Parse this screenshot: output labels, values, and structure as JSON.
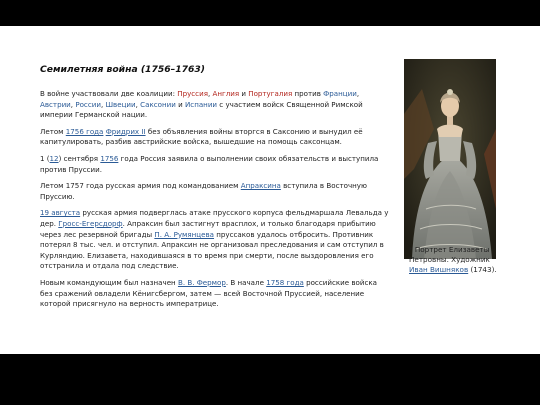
{
  "article": {
    "title": "Семилетняя война (1756–1763)",
    "p1": {
      "t1": "В войне участвовали две коалиции: ",
      "prussia": "Пруссия",
      "c1": ", ",
      "england": "Англия",
      "t2": " и ",
      "portugal": "Португалия",
      "t3": " против ",
      "france": "Франции",
      "c2": ", ",
      "austria": "Австрии",
      "c3": ", ",
      "russia": "России",
      "c4": ", ",
      "sweden": "Швеции",
      "c5": ", ",
      "saxony": "Саксонии",
      "t4": " и ",
      "spain": "Испании",
      "t5": " с участием войск Священной Римской империи Германской нации."
    },
    "p2": {
      "t1": "Летом ",
      "link_year": "1756 года",
      "t2": " ",
      "link_king": "Фридрих II",
      "t3": " без объявления войны вторгся в Саксонию и вынудил её капитулировать, разбив австрийские войска, вышедшие на помощь саксонцам."
    },
    "p3": {
      "t1": "1 (",
      "link_day": "12",
      "t2": ") сентября ",
      "link_year": "1756",
      "t3": " года Россия заявила о выполнении своих обязательств и выступила против Пруссии."
    },
    "p4": {
      "t1": "Летом 1757 года русская армия под командованием ",
      "link_apraksin": "Апраксина",
      "t2": " вступила в Восточную Пруссию."
    },
    "p5": {
      "link_date": "19 августа",
      "t1": " русская армия подверглась атаке прусского корпуса фельдмаршала Левальда у дер. ",
      "link_village": "Гросс-Егерсдорф",
      "t2": ". Апраксин был застигнут врасплох, и только благодаря прибытию через лес резервной бригады ",
      "link_rumyantsev": "П. А. Румянцева",
      "t3": " пруссаков удалось отбросить. Противник потерял 8 тыс. чел. и отступил. Апраксин не организовал преследования и сам отступил в Курляндию. Елизавета, находившаяся в то время при смерти, после выздоровления его отстранила и отдала под следствие."
    },
    "p6": {
      "t1": "Новым командующим был назначен ",
      "link_fermor": "В. В. Фермор",
      "t2": ". В начале ",
      "link_year": "1758 года",
      "t3": " российские войска без сражений овладели Кёнигсбергом, затем — всей Восточной Пруссией, население которой присягнуло на верность императрице."
    }
  },
  "caption": {
    "t1": "* Портрет Елизаветы Петровны. Художник ",
    "link_painter": "Иван Вишняков",
    "t2": " (1743)."
  },
  "colors": {
    "background": "#000000",
    "slide": "#ffffff",
    "text": "#222222",
    "red_term": "#b3261e",
    "blue_term": "#2a5a96"
  }
}
